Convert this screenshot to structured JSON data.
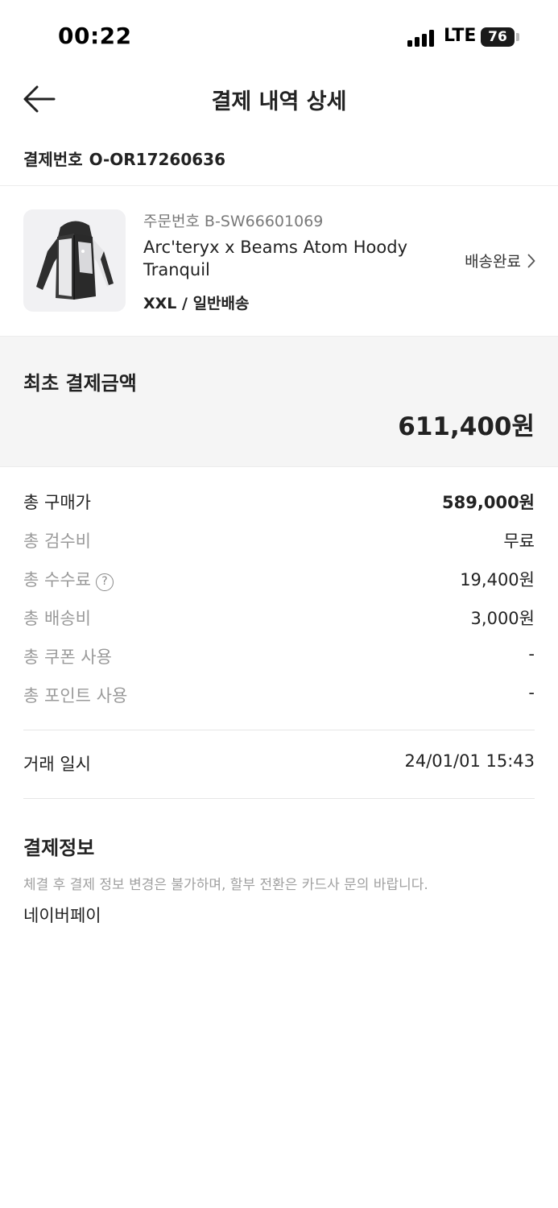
{
  "status_bar": {
    "time": "00:22",
    "network": "LTE",
    "battery": "76"
  },
  "header": {
    "title": "결제 내역 상세",
    "back_icon": "arrow-left-icon"
  },
  "payment": {
    "label": "결제번호",
    "number": "O-OR17260636"
  },
  "product": {
    "order_label": "주문번호",
    "order_number": "B-SW66601069",
    "name": "Arc'teryx x Beams Atom Hoody Tranquil",
    "option": "XXL / 일반배송",
    "status": "배송완료",
    "status_icon": "chevron-right-icon",
    "image_icon": "jacket-image"
  },
  "total": {
    "label": "최초 결제금액",
    "amount": "611,400원"
  },
  "breakdown": [
    {
      "label": "총 구매가",
      "value": "589,000원"
    },
    {
      "label": "총 검수비",
      "value": "무료"
    },
    {
      "label": "총 수수료",
      "value": "19,400원",
      "help_icon": "?"
    },
    {
      "label": "총 배송비",
      "value": "3,000원"
    },
    {
      "label": "총 쿠폰 사용",
      "value": "-"
    },
    {
      "label": "총 포인트 사용",
      "value": "-"
    }
  ],
  "trade": {
    "label": "거래 일시",
    "value": "24/01/01 15:43"
  },
  "payment_info": {
    "title": "결제정보",
    "note": "체결 후 결제 정보 변경은 불가하며, 할부 전환은 카드사 문의 바랍니다.",
    "method": "네이버페이"
  },
  "colors": {
    "primary_text": "#222222",
    "secondary_text": "#9a9a9a",
    "total_box_bg": "#f5f5f5",
    "thumb_bg": "#f1f1f3"
  }
}
